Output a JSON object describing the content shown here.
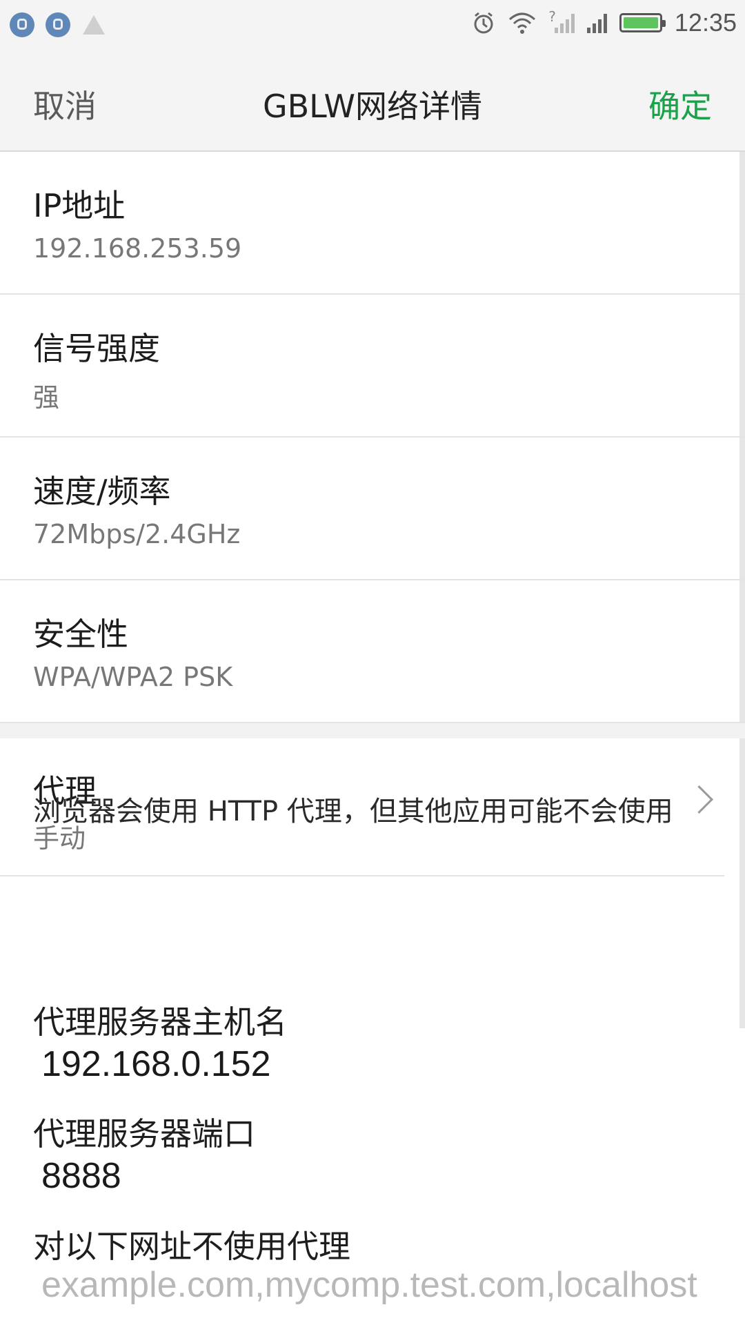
{
  "status_bar": {
    "time": "12:35"
  },
  "header": {
    "cancel_label": "取消",
    "title": "GBLW网络详情",
    "confirm_label": "确定"
  },
  "details": [
    {
      "label": "IP地址",
      "value": "192.168.253.59"
    },
    {
      "label": "信号强度",
      "value": "强"
    },
    {
      "label": "速度/频率",
      "value": "72Mbps/2.4GHz"
    },
    {
      "label": "安全性",
      "value": "WPA/WPA2 PSK"
    }
  ],
  "proxy": {
    "label": "代理",
    "value": "手动",
    "note": "浏览器会使用 HTTP 代理，但其他应用可能不会使用",
    "host_label": "代理服务器主机名",
    "host_value": "192.168.0.152",
    "port_label": "代理服务器端口",
    "port_value": "8888",
    "bypass_label": "对以下网址不使用代理",
    "bypass_placeholder": "example.com,mycomp.test.com,localhost"
  },
  "colors": {
    "confirm": "#1aa24a",
    "battery": "#5ec45e"
  }
}
